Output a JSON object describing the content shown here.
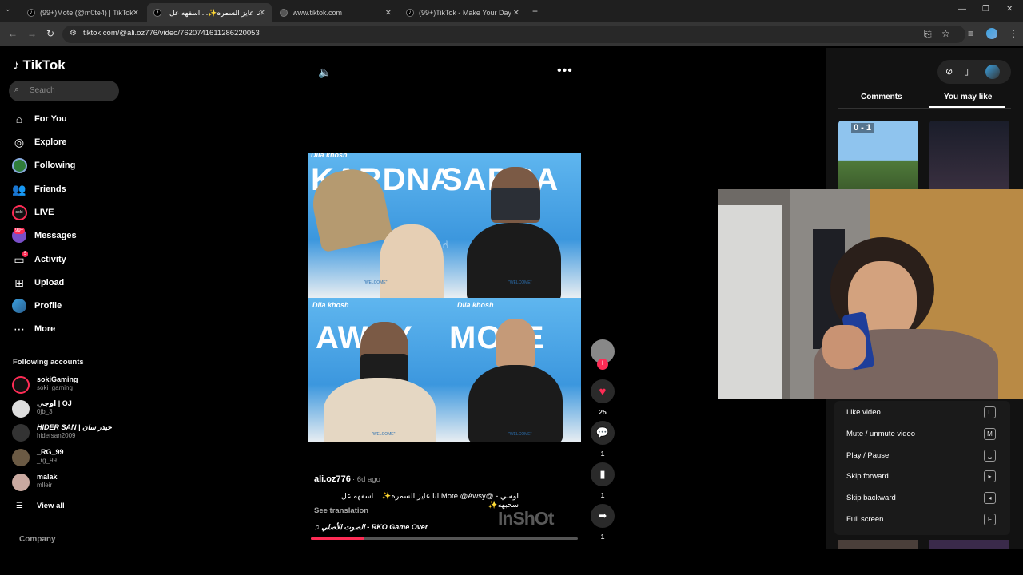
{
  "browser": {
    "tabs": [
      {
        "title": "(99+)Mote (@m0te4) | TikTok"
      },
      {
        "title": "انا عايز السمره✨... اسفهه عل"
      },
      {
        "title": "www.tiktok.com"
      },
      {
        "title": "(99+)TikTok - Make Your Day"
      }
    ],
    "url": "tiktok.com/@ali.oz776/video/7620741611286220053"
  },
  "sidebar": {
    "logo": "TikTok",
    "search_placeholder": "Search",
    "nav": [
      {
        "label": "For You",
        "icon": "home-icon"
      },
      {
        "label": "Explore",
        "icon": "compass-icon"
      },
      {
        "label": "Following",
        "icon": "following-avatar-icon"
      },
      {
        "label": "Friends",
        "icon": "friends-icon"
      },
      {
        "label": "LIVE",
        "icon": "live-icon"
      },
      {
        "label": "Messages",
        "icon": "messages-icon",
        "badge": "99+"
      },
      {
        "label": "Activity",
        "icon": "activity-icon",
        "badge": "5"
      },
      {
        "label": "Upload",
        "icon": "upload-icon"
      },
      {
        "label": "Profile",
        "icon": "profile-avatar-icon"
      },
      {
        "label": "More",
        "icon": "more-dots-icon"
      }
    ],
    "following_header": "Following accounts",
    "accounts": [
      {
        "name": "sokiGaming",
        "handle": "soki_gaming"
      },
      {
        "name": "اوجي | OJ",
        "handle": "0jb_3"
      },
      {
        "name": "HIDER SAN | حيدر سان",
        "handle": "hidersan2009"
      },
      {
        "name": "_RG_99",
        "handle": "_rg_99"
      },
      {
        "name": "malak",
        "handle": "mlleir"
      }
    ],
    "view_all": "View all",
    "company": "Company"
  },
  "video": {
    "panels": [
      {
        "brand": "Dila khosh",
        "word": "KARDNA",
        "welcome": "\"WELCOME\""
      },
      {
        "brand": "",
        "word": "SABRA",
        "welcome": "\"WELCOME\""
      },
      {
        "brand": "Dila khosh",
        "word": "AWSY",
        "welcome": "\"WELCOME\""
      },
      {
        "brand": "Dila khosh",
        "word": "MOTE",
        "welcome": "\"WELCOME\""
      }
    ],
    "author": "ali.oz776",
    "time": "· 6d ago",
    "caption": "اوسي - @Mote @Awsy انا عايز السمره✨... اسفهه عل سحبهه✨",
    "see_translation": "See translation",
    "music": "الصوت الأصلي - RKO Game Over",
    "watermark": "InShOt",
    "progress": 0.2
  },
  "actions": {
    "likes": "25",
    "comments": "1",
    "saves": "1",
    "shares": "1"
  },
  "right_panel": {
    "tab_comments": "Comments",
    "tab_you_may_like": "You may like",
    "thumb1_score": "0 - 1"
  },
  "shortcuts": [
    {
      "label": "Like video",
      "key": "L"
    },
    {
      "label": "Mute / unmute video",
      "key": "M"
    },
    {
      "label": "Play / Pause",
      "key": "␣"
    },
    {
      "label": "Skip forward",
      "key": "▸"
    },
    {
      "label": "Skip backward",
      "key": "◂"
    },
    {
      "label": "Full screen",
      "key": "F"
    }
  ],
  "colors": {
    "accent": "#fe2c55",
    "background": "#000000"
  }
}
